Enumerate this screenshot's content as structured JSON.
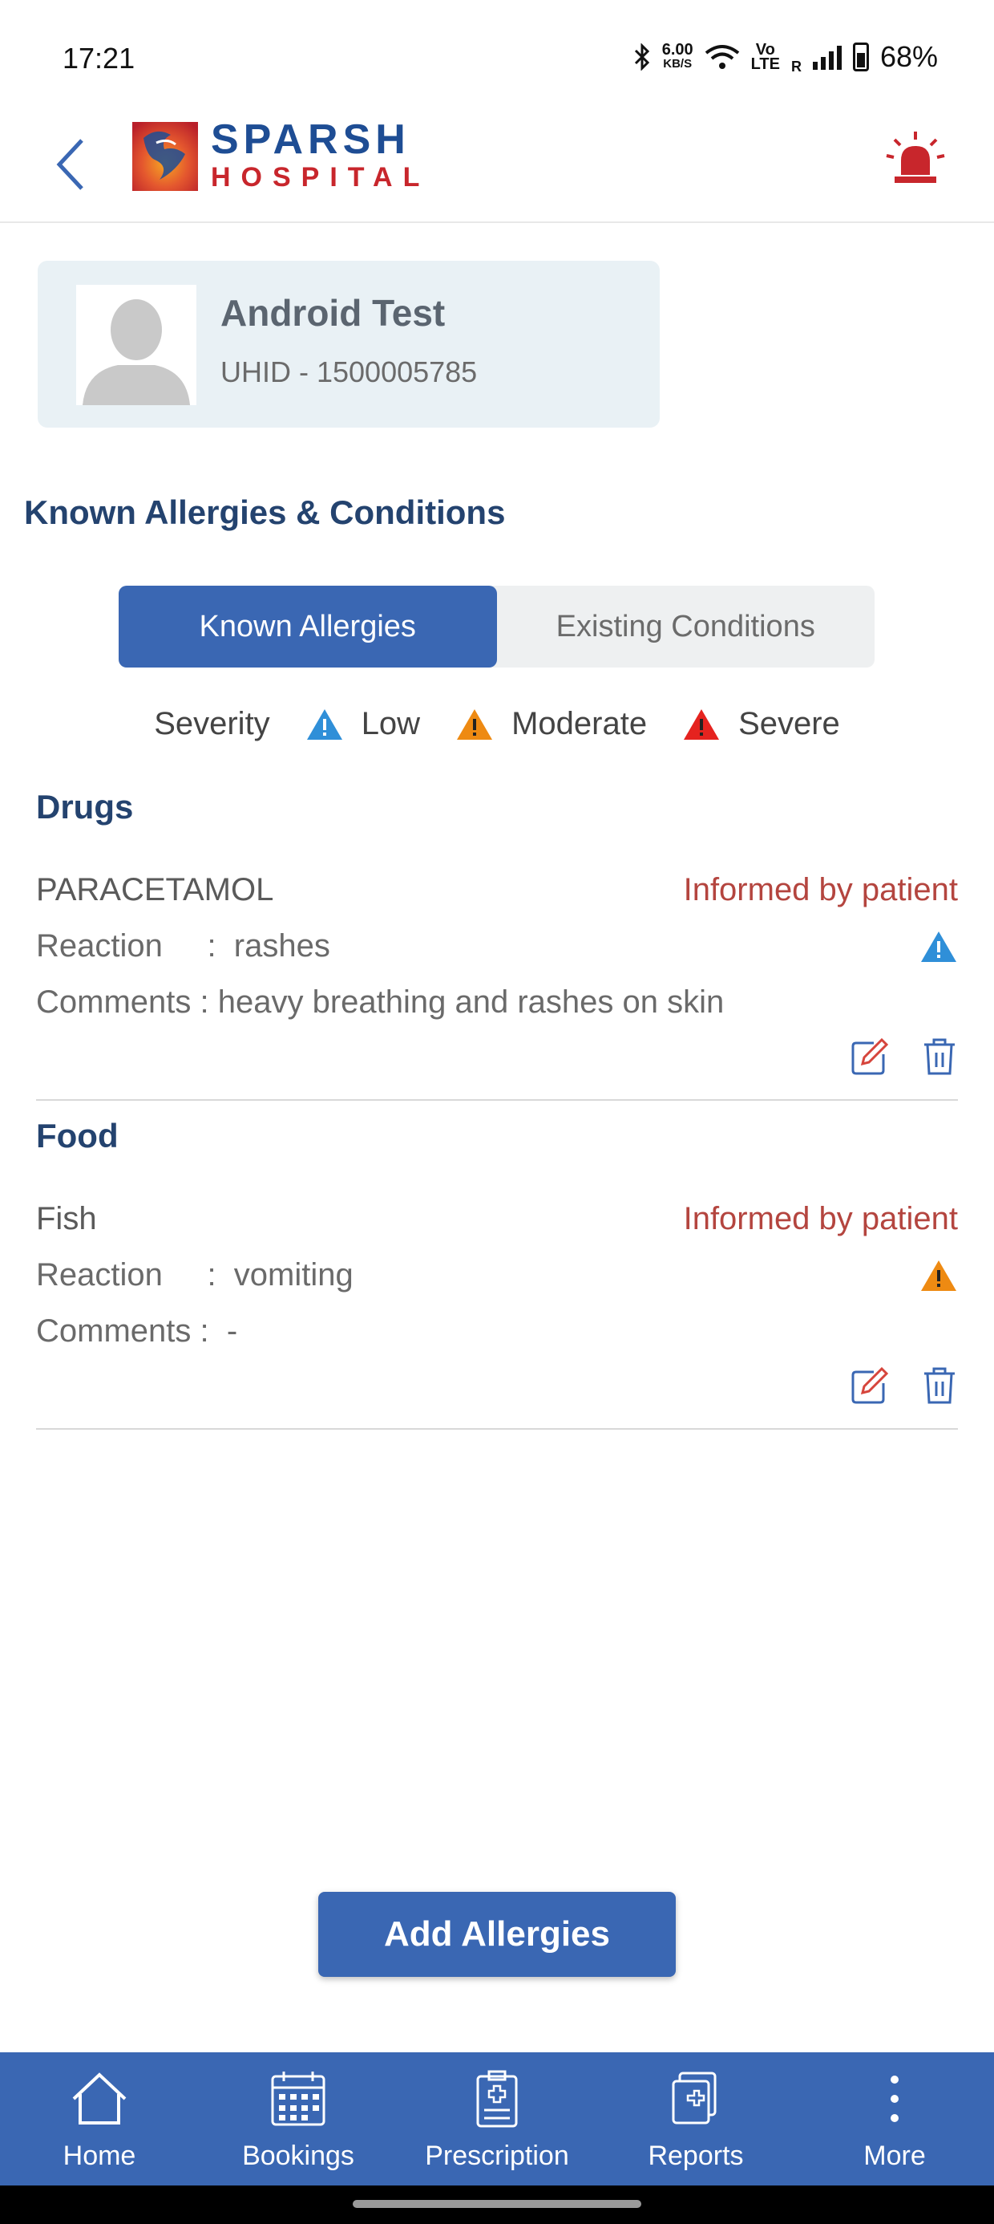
{
  "status_bar": {
    "time": "17:21",
    "net_speed": "6.00",
    "net_unit": "KB/S",
    "volte_top": "Vo",
    "volte_bottom": "LTE",
    "roaming": "R",
    "battery": "68%"
  },
  "header": {
    "logo_line1": "SPARSH",
    "logo_line2": "HOSPITAL",
    "back_icon": "chevron-left-icon",
    "alarm_icon": "siren-icon",
    "accent_color": "#1e4d94",
    "alarm_color": "#c8262c"
  },
  "patient": {
    "name": "Android  Test",
    "uhid": "UHID - 1500005785"
  },
  "page_title": "Known Allergies & Conditions",
  "tabs": [
    {
      "label": "Known Allergies",
      "active": true
    },
    {
      "label": "Existing Conditions",
      "active": false
    }
  ],
  "legend": {
    "title": "Severity",
    "items": [
      {
        "label": "Low",
        "color": "#2f8fd8"
      },
      {
        "label": "Moderate",
        "color": "#ee8a12"
      },
      {
        "label": "Severe",
        "color": "#e5231f"
      }
    ]
  },
  "categories": [
    {
      "name": "Drugs",
      "entries": [
        {
          "name": "PARACETAMOL",
          "source": "Informed by patient",
          "reaction_label": "Reaction     :",
          "reaction": "rashes",
          "comments_label": "Comments :",
          "comments": "heavy breathing and rashes on skin",
          "severity": "Low",
          "severity_color": "#2f8fd8"
        }
      ]
    },
    {
      "name": "Food",
      "entries": [
        {
          "name": "Fish",
          "source": "Informed by patient",
          "reaction_label": "Reaction     :",
          "reaction": "vomiting",
          "comments_label": "Comments :",
          "comments": "-",
          "severity": "Moderate",
          "severity_color": "#ee8a12"
        }
      ]
    }
  ],
  "add_button": "Add Allergies",
  "nav": [
    {
      "label": "Home",
      "icon": "home-icon"
    },
    {
      "label": "Bookings",
      "icon": "calendar-icon"
    },
    {
      "label": "Prescription",
      "icon": "prescription-clipboard-icon"
    },
    {
      "label": "Reports",
      "icon": "reports-icon"
    },
    {
      "label": "More",
      "icon": "more-vertical-icon"
    }
  ],
  "colors": {
    "primary": "#3a67b3",
    "heading": "#24436f",
    "informed": "#b4453f"
  }
}
